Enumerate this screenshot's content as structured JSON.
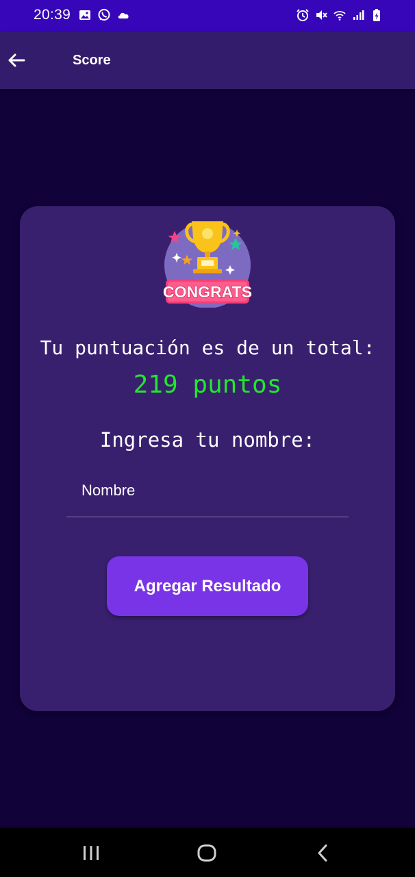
{
  "status_bar": {
    "time": "20:39",
    "left_icons": [
      "image-icon",
      "whatsapp-icon",
      "cloud-icon"
    ],
    "right_icons": [
      "alarm-icon",
      "mute-icon",
      "wifi-icon",
      "signal-icon",
      "battery-charging-icon"
    ]
  },
  "app_bar": {
    "title": "Score",
    "back_icon": "arrow-left-icon"
  },
  "card": {
    "badge_text": "CONGRATS",
    "score_label": "Tu puntuación es de un total:",
    "score_value": "219 puntos",
    "name_prompt": "Ingresa tu nombre:",
    "name_input": {
      "placeholder": "Nombre",
      "value": ""
    },
    "submit_button": "Agregar Resultado"
  },
  "nav_bar": {
    "buttons": [
      "recents-icon",
      "home-icon",
      "back-icon"
    ]
  },
  "colors": {
    "status_bar": "#3606b8",
    "app_bar": "#341c6c",
    "background": "#11023a",
    "card": "#39206f",
    "score_value": "#21e82c",
    "button": "#7a34e8"
  }
}
